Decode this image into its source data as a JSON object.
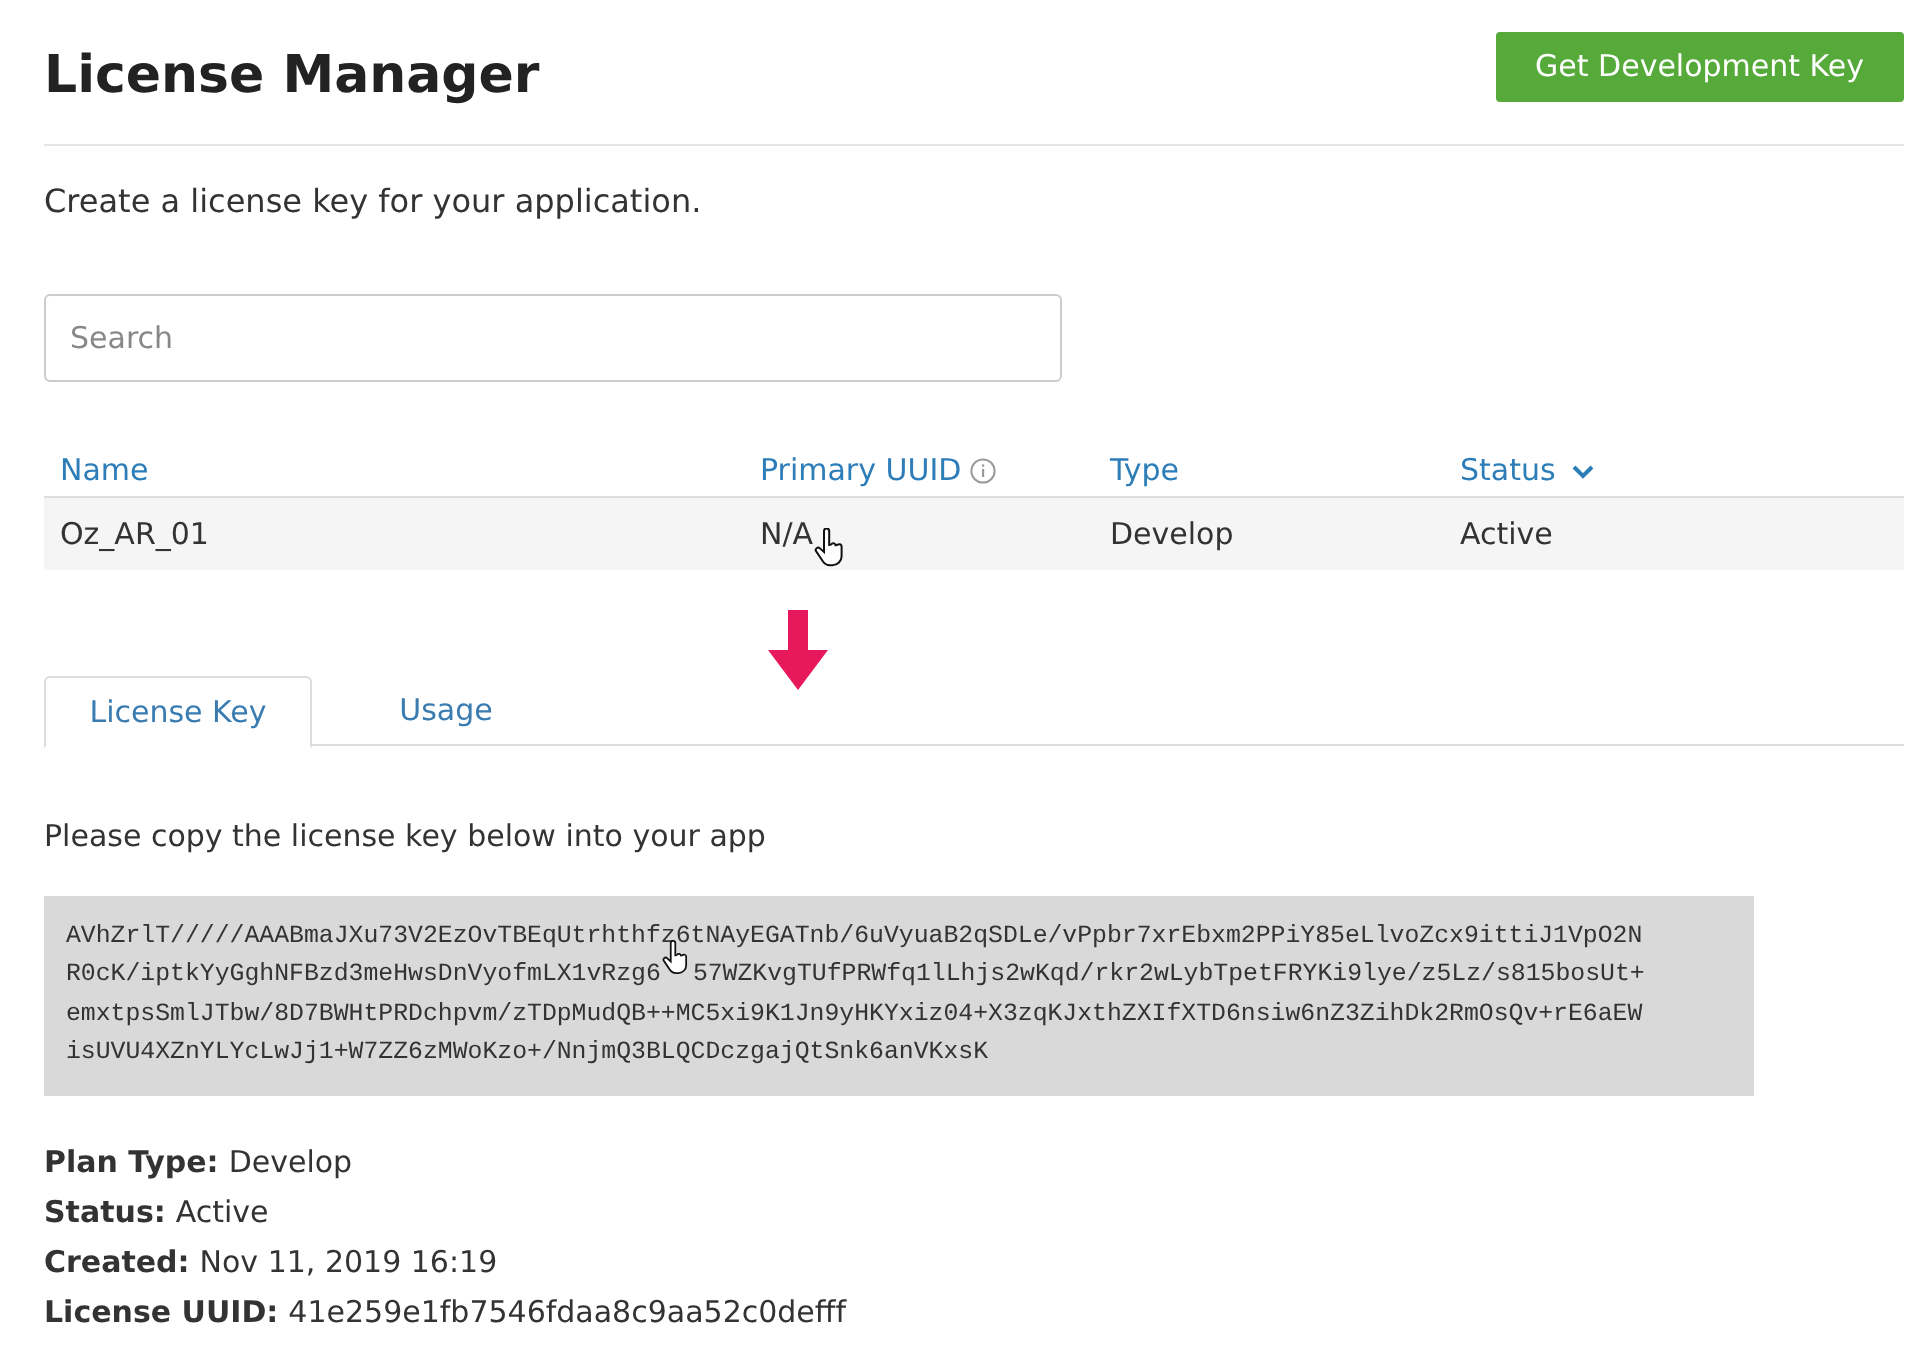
{
  "header": {
    "title": "License Manager",
    "button": "Get Development Key"
  },
  "subtitle": "Create a license key for your application.",
  "search": {
    "placeholder": "Search"
  },
  "table": {
    "columns": [
      {
        "label": "Name",
        "kind": "plain"
      },
      {
        "label": "Primary UUID",
        "kind": "info"
      },
      {
        "label": "Type",
        "kind": "plain"
      },
      {
        "label": "Status",
        "kind": "sortable"
      }
    ],
    "rows": [
      {
        "cells": [
          "Oz_AR_01",
          "N/A",
          "Develop",
          "Active"
        ]
      }
    ]
  },
  "tabs": [
    {
      "label": "License Key",
      "selected": true
    },
    {
      "label": "Usage",
      "selected": false
    }
  ],
  "instruction": "Please copy the license key below into your app",
  "license_key": [
    [
      "AVhZrlT/////AAABmaJXu73V2EzOvTBEqUtrhthfz6tNAyEGATnb/6uVyuaB2qSDLe/vPpbr7xrEbxm2PPiY85eLlvoZcx9ittiJ1VpO2N"
    ],
    [
      "R0cK/iptkYyGghNFBzd3meHwsDnVyofmLX1vRzg6",
      "57WZKvgTUfPRWfq1lLhjs2wKqd/rkr2wLybTpetFRYKi9lye/z5Lz/s815bosUt+"
    ],
    [
      "emxtpsSmlJTbw/8D7BWHtPRDchpvm/zTDpMudQB++MC5xi9K1Jn9yHKYxiz04+X3zqKJxthZXIfXTD6nsiw6nZ3ZihDk2RmOsQv+rE6aEW"
    ],
    [
      "isUVU4XZnYLYcLwJj1+W7ZZ6zMWoKzo+/NnjmQ3BLQCDczgajQtSnk6anVKxsK"
    ]
  ],
  "details": [
    {
      "label": "Plan Type:",
      "value": "Develop"
    },
    {
      "label": "Status:",
      "value": "Active"
    },
    {
      "label": "Created:",
      "value": "Nov 11, 2019 16:19"
    },
    {
      "label": "License UUID:",
      "value": "41e259e1fb7546fdaa8c9aa52c0defff"
    }
  ]
}
